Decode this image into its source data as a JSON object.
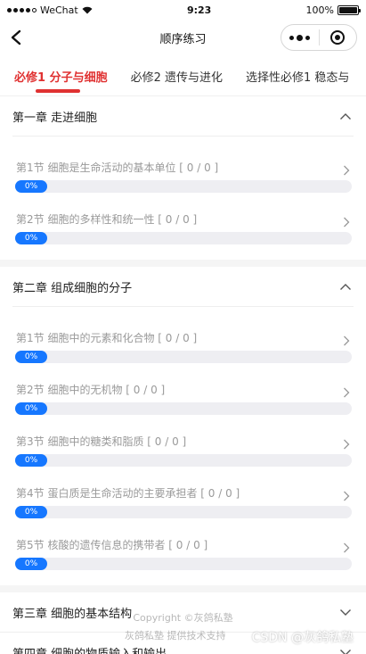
{
  "status": {
    "carrier": "WeChat",
    "time": "9:23",
    "battery": "100%",
    "battery_level": 1.0
  },
  "nav": {
    "title": "顺序练习"
  },
  "tabs": [
    {
      "label": "必修1 分子与细胞",
      "active": true
    },
    {
      "label": "必修2 遗传与进化",
      "active": false
    },
    {
      "label": "选择性必修1 稳态与",
      "active": false
    }
  ],
  "chapters": [
    {
      "title": "第一章 走进细胞",
      "expanded": true,
      "sections": [
        {
          "title": "第1节 细胞是生命活动的基本单位 [ 0 / 0 ]",
          "progress_label": "0%",
          "progress": 0
        },
        {
          "title": "第2节 细胞的多样性和统一性 [ 0 / 0 ]",
          "progress_label": "0%",
          "progress": 0
        }
      ]
    },
    {
      "title": "第二章 组成细胞的分子",
      "expanded": true,
      "sections": [
        {
          "title": "第1节 细胞中的元素和化合物 [ 0 / 0 ]",
          "progress_label": "0%",
          "progress": 0
        },
        {
          "title": "第2节 细胞中的无机物 [ 0 / 0 ]",
          "progress_label": "0%",
          "progress": 0
        },
        {
          "title": "第3节 细胞中的糖类和脂质 [ 0 / 0 ]",
          "progress_label": "0%",
          "progress": 0
        },
        {
          "title": "第4节 蛋白质是生命活动的主要承担者 [ 0 / 0 ]",
          "progress_label": "0%",
          "progress": 0
        },
        {
          "title": "第5节 核酸的遗传信息的携带者 [ 0 / 0 ]",
          "progress_label": "0%",
          "progress": 0
        }
      ]
    },
    {
      "title": "第三章 细胞的基本结构",
      "expanded": false,
      "sections": []
    },
    {
      "title": "第四章 细胞的物质输入和输出",
      "expanded": false,
      "sections": []
    }
  ],
  "footer": {
    "copyright": "Copyright ©灰鸽私塾",
    "support": "灰鸽私塾 提供技术支持",
    "watermark": "CSDN @灰鸽私塾"
  },
  "colors": {
    "accent_red": "#e03131",
    "progress_blue": "#1677ff",
    "track_gray": "#eeeef2"
  }
}
